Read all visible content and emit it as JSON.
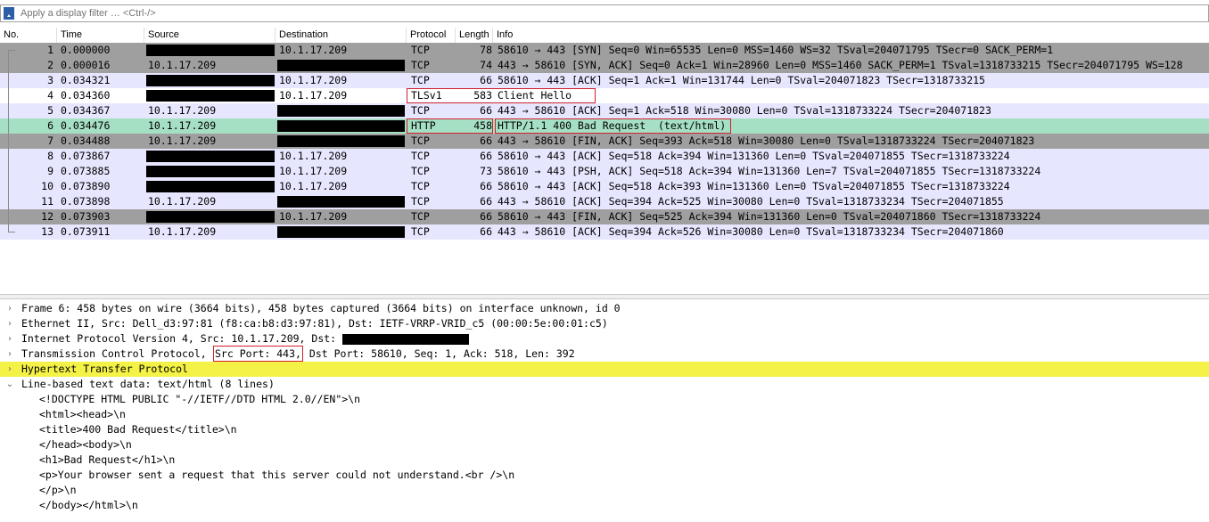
{
  "filter": {
    "placeholder": "Apply a display filter … <Ctrl-/>"
  },
  "columns": [
    "No.",
    "Time",
    "Source",
    "Destination",
    "Protocol",
    "Length",
    "Info"
  ],
  "colors": {
    "tcp_rst_gray": "#a0a0a0",
    "tcp_lavender": "#e7e6ff",
    "http_green": "#e4ffc7",
    "selected_green": "#a6e0c4",
    "dark_gray": "#9f9f9f",
    "highlight_yellow": "#f4f247",
    "highlight_red": "#d0202c"
  },
  "packets": [
    {
      "no": "1",
      "time": "0.000000",
      "src": "",
      "dst": "10.1.17.209",
      "proto": "TCP",
      "len": "78",
      "info": "58610 → 443 [SYN] Seq=0 Win=65535 Len=0 MSS=1460 WS=32 TSval=204071795 TSecr=0 SACK_PERM=1",
      "style": "gray"
    },
    {
      "no": "2",
      "time": "0.000016",
      "src": "10.1.17.209",
      "dst": "",
      "proto": "TCP",
      "len": "74",
      "info": "443 → 58610 [SYN, ACK] Seq=0 Ack=1 Win=28960 Len=0 MSS=1460 SACK_PERM=1 TSval=1318733215 TSecr=204071795 WS=128",
      "style": "gray"
    },
    {
      "no": "3",
      "time": "0.034321",
      "src": "",
      "dst": "10.1.17.209",
      "proto": "TCP",
      "len": "66",
      "info": "58610 → 443 [ACK] Seq=1 Ack=1 Win=131744 Len=0 TSval=204071823 TSecr=1318733215",
      "style": "lav"
    },
    {
      "no": "4",
      "time": "0.034360",
      "src": "",
      "dst": "10.1.17.209",
      "proto": "TLSv1",
      "len": "583",
      "info": "Client Hello",
      "style": "white"
    },
    {
      "no": "5",
      "time": "0.034367",
      "src": "10.1.17.209",
      "dst": "",
      "proto": "TCP",
      "len": "66",
      "info": "443 → 58610 [ACK] Seq=1 Ack=518 Win=30080 Len=0 TSval=1318733224 TSecr=204071823",
      "style": "lav"
    },
    {
      "no": "6",
      "time": "0.034476",
      "src": "10.1.17.209",
      "dst": "",
      "proto": "HTTP",
      "len": "458",
      "info": "HTTP/1.1 400 Bad Request  (text/html)",
      "style": "sel"
    },
    {
      "no": "7",
      "time": "0.034488",
      "src": "10.1.17.209",
      "dst": "",
      "proto": "TCP",
      "len": "66",
      "info": "443 → 58610 [FIN, ACK] Seq=393 Ack=518 Win=30080 Len=0 TSval=1318733224 TSecr=204071823",
      "style": "gray"
    },
    {
      "no": "8",
      "time": "0.073867",
      "src": "",
      "dst": "10.1.17.209",
      "proto": "TCP",
      "len": "66",
      "info": "58610 → 443 [ACK] Seq=518 Ack=394 Win=131360 Len=0 TSval=204071855 TSecr=1318733224",
      "style": "lav"
    },
    {
      "no": "9",
      "time": "0.073885",
      "src": "",
      "dst": "10.1.17.209",
      "proto": "TCP",
      "len": "73",
      "info": "58610 → 443 [PSH, ACK] Seq=518 Ack=394 Win=131360 Len=7 TSval=204071855 TSecr=1318733224",
      "style": "lav"
    },
    {
      "no": "10",
      "time": "0.073890",
      "src": "",
      "dst": "10.1.17.209",
      "proto": "TCP",
      "len": "66",
      "info": "58610 → 443 [ACK] Seq=518 Ack=393 Win=131360 Len=0 TSval=204071855 TSecr=1318733224",
      "style": "lav"
    },
    {
      "no": "11",
      "time": "0.073898",
      "src": "10.1.17.209",
      "dst": "",
      "proto": "TCP",
      "len": "66",
      "info": "443 → 58610 [ACK] Seq=394 Ack=525 Win=30080 Len=0 TSval=1318733234 TSecr=204071855",
      "style": "lav"
    },
    {
      "no": "12",
      "time": "0.073903",
      "src": "",
      "dst": "10.1.17.209",
      "proto": "TCP",
      "len": "66",
      "info": "58610 → 443 [FIN, ACK] Seq=525 Ack=394 Win=131360 Len=0 TSval=204071860 TSecr=1318733224",
      "style": "gray"
    },
    {
      "no": "13",
      "time": "0.073911",
      "src": "10.1.17.209",
      "dst": "",
      "proto": "TCP",
      "len": "66",
      "info": "443 → 58610 [ACK] Seq=394 Ack=526 Win=30080 Len=0 TSval=1318733234 TSecr=204071860",
      "style": "lav"
    }
  ],
  "details": {
    "frame": "Frame 6: 458 bytes on wire (3664 bits), 458 bytes captured (3664 bits) on interface unknown, id 0",
    "ethernet": "Ethernet II, Src: Dell_d3:97:81 (f8:ca:b8:d3:97:81), Dst: IETF-VRRP-VRID_c5 (00:00:5e:00:01:c5)",
    "ip": "Internet Protocol Version 4, Src: 10.1.17.209, Dst:",
    "tcp_prefix": "Transmission Control Protocol, ",
    "tcp_src": "Src Port: 443,",
    "tcp_rest": " Dst Port: 58610, Seq: 1, Ack: 518, Len: 392",
    "http": "Hypertext Transfer Protocol",
    "linebased": "Line-based text data: text/html (8 lines)",
    "lines": [
      "<!DOCTYPE HTML PUBLIC \"-//IETF//DTD HTML 2.0//EN\">\\n",
      "<html><head>\\n",
      "<title>400 Bad Request</title>\\n",
      "</head><body>\\n",
      "<h1>Bad Request</h1>\\n",
      "<p>Your browser sent a request that this server could not understand.<br />\\n",
      "</p>\\n",
      "</body></html>\\n"
    ],
    "arrows": {
      "collapsed": "›",
      "expanded": "⌄"
    }
  }
}
